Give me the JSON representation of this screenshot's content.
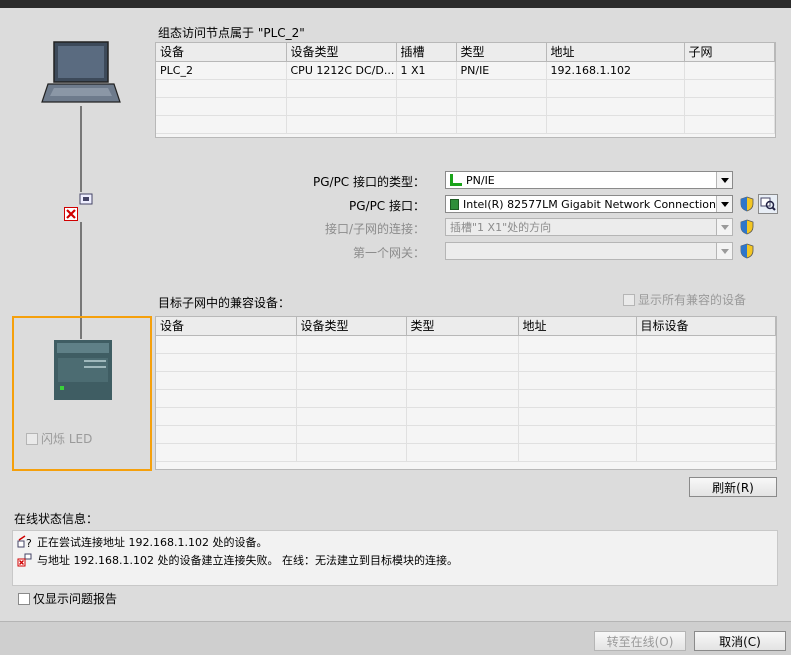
{
  "access_table": {
    "title": "组态访问节点属于 \"PLC_2\"",
    "columns": [
      "设备",
      "设备类型",
      "插槽",
      "类型",
      "地址",
      "子网"
    ],
    "rows": [
      [
        "PLC_2",
        "CPU 1212C DC/D...",
        "1 X1",
        "PN/IE",
        "192.168.1.102",
        ""
      ]
    ]
  },
  "interface_form": {
    "type_label": "PG/PC 接口的类型：",
    "type_value": "PN/IE",
    "interface_label": "PG/PC 接口：",
    "interface_value": "Intel(R) 82577LM Gigabit Network Connection",
    "subnet_label": "接口/子网的连接：",
    "subnet_value": "插槽\"1 X1\"处的方向",
    "gateway_label": "第一个网关：",
    "gateway_value": ""
  },
  "target_table": {
    "title": "目标子网中的兼容设备：",
    "show_all_label": "显示所有兼容的设备",
    "columns": [
      "设备",
      "设备类型",
      "类型",
      "地址",
      "目标设备"
    ]
  },
  "left_panel": {
    "flash_led_label": "闪烁 LED"
  },
  "refresh_label": "刷新(R)",
  "status": {
    "title": "在线状态信息：",
    "lines": [
      "正在尝试连接地址 192.168.1.102 处的设备。",
      "与地址 192.168.1.102 处的设备建立连接失败。 在线：无法建立到目标模块的连接。"
    ],
    "only_problems_label": "仅显示问题报告"
  },
  "footer": {
    "go_online_label": "转至在线(O)",
    "cancel_label": "取消(C)"
  },
  "colors": {
    "highlight_border": "#f5a00c",
    "error_red": "#d00000",
    "pn_green": "#1aa31a"
  }
}
